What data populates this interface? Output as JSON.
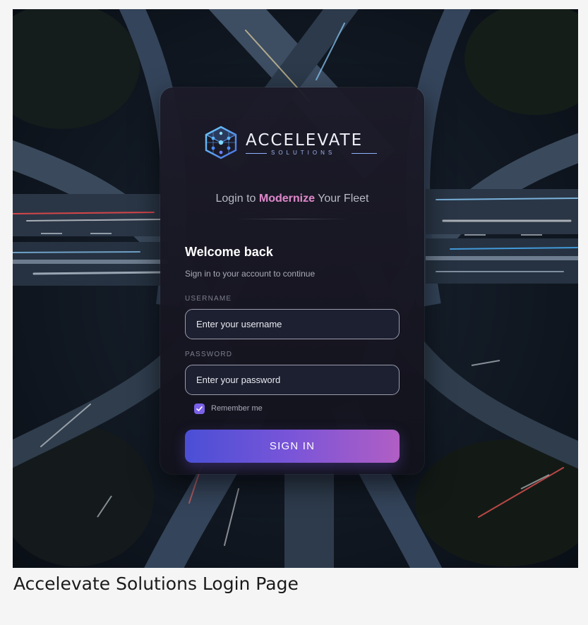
{
  "brand": {
    "name": "ACCELEVATE",
    "subtext": "SOLUTIONS",
    "logo_icon": "cube-network-icon"
  },
  "tagline": {
    "prefix": "Login to ",
    "highlight": "Modernize",
    "suffix": " Your Fleet"
  },
  "form": {
    "heading": "Welcome back",
    "subheading": "Sign in to your account to continue",
    "username_label": "USERNAME",
    "username_placeholder": "Enter your username",
    "username_value": "",
    "password_label": "PASSWORD",
    "password_placeholder": "Enter your password",
    "password_value": "",
    "remember_label": "Remember me",
    "remember_checked": true,
    "submit_label": "SIGN IN"
  },
  "caption": "Accelevate Solutions Login Page",
  "colors": {
    "accent_start": "#4a4fd6",
    "accent_end": "#b15ec4",
    "highlight": "#d684c4",
    "card_bg": "#1c1a28"
  }
}
